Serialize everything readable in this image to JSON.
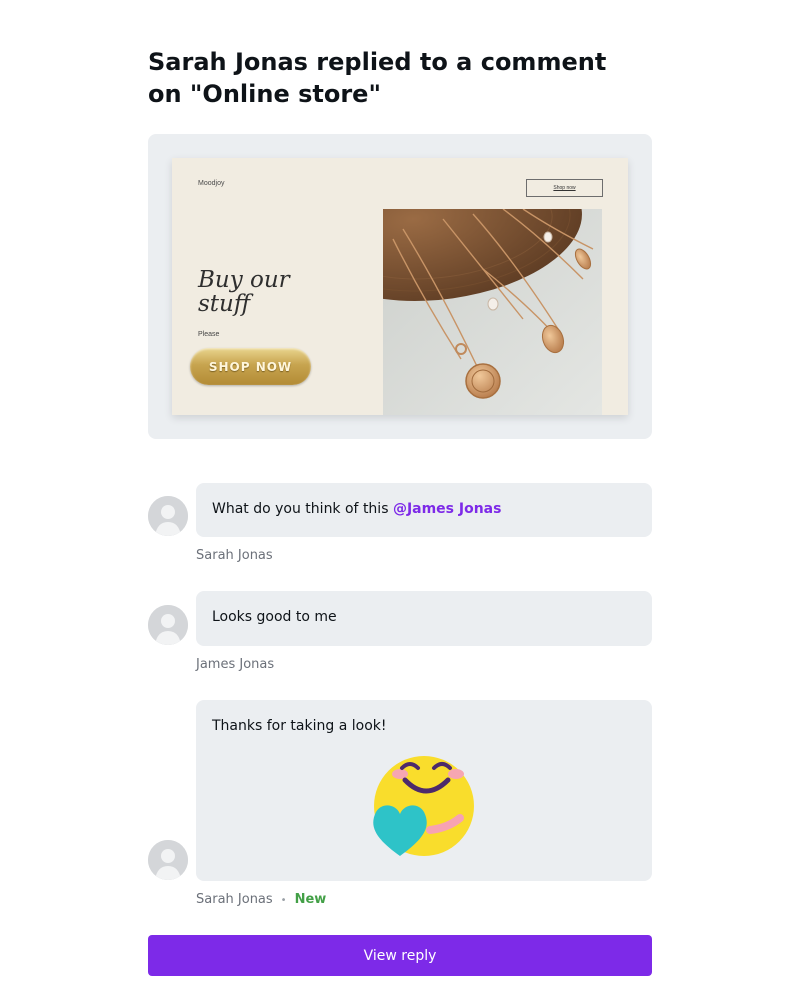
{
  "heading": "Sarah Jonas replied to a comment on \"Online store\"",
  "preview": {
    "brand": "Moodjoy",
    "top_button": "Shop now",
    "title": "Buy our stuff",
    "subtitle": "Please",
    "cta": "SHOP NOW"
  },
  "comments": [
    {
      "text": "What do you think of this ",
      "mention": "@James Jonas",
      "author": "Sarah Jonas"
    },
    {
      "text": "Looks good to me",
      "author": "James Jonas"
    },
    {
      "text": "Thanks for taking a look!",
      "author": "Sarah Jonas",
      "badge": "New",
      "sticker": "hugging-face-with-heart-icon"
    }
  ],
  "action": {
    "label": "View reply"
  },
  "colors": {
    "accent": "#7d2ae8",
    "bubble": "#ebeef1",
    "new_badge": "#43a047",
    "author": "#6b7079"
  }
}
